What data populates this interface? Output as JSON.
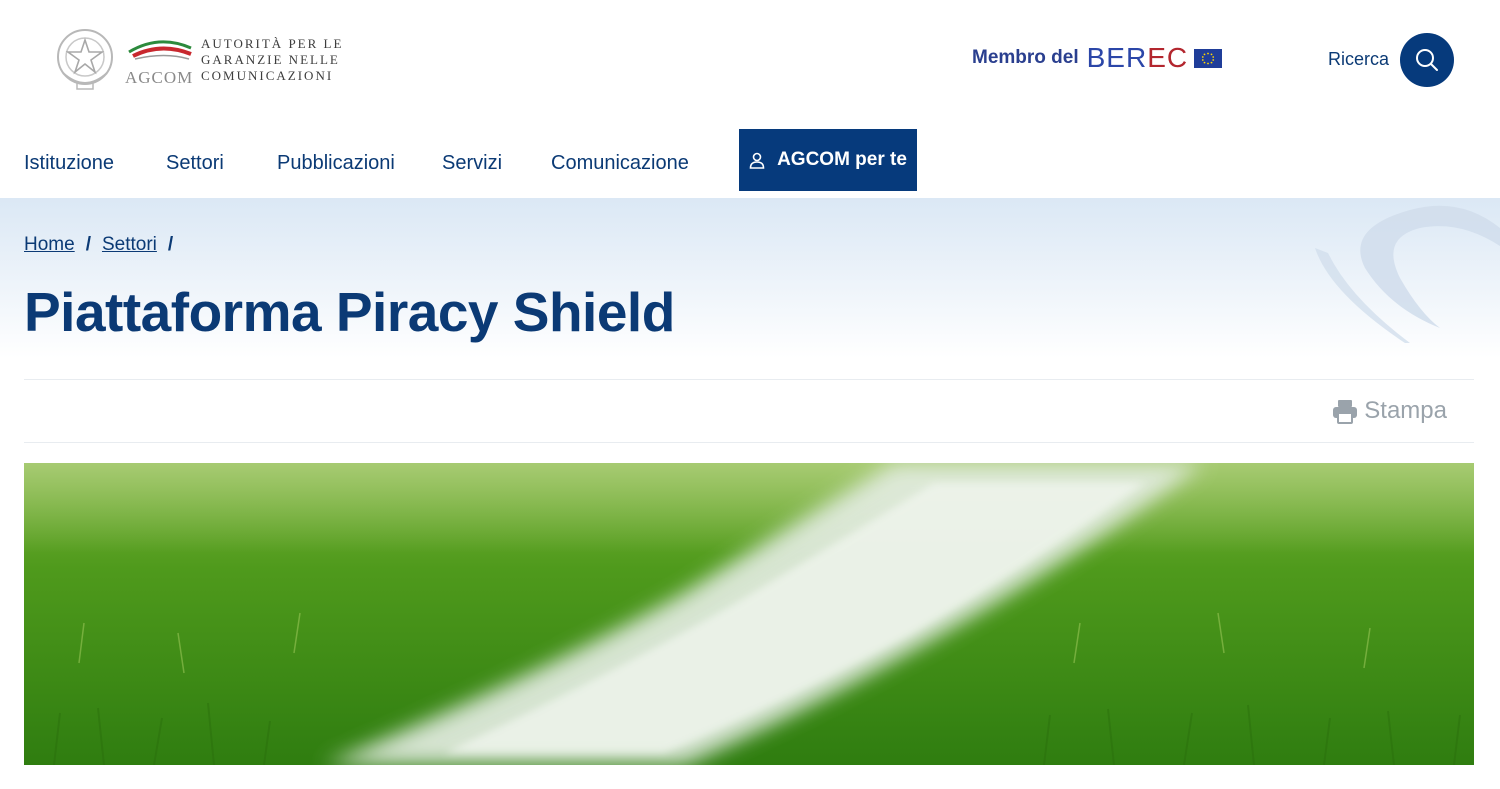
{
  "header": {
    "logo": {
      "org_line1": "AUTORITÀ PER LE",
      "org_line2": "GARANZIE NELLE",
      "org_line3": "COMUNICAZIONI",
      "mark_text": "AGCOM"
    },
    "berec": {
      "prefix": "Membro del",
      "brand_main": "BER",
      "brand_accent": "EC"
    },
    "search": {
      "label": "Ricerca",
      "icon": "search-icon"
    }
  },
  "nav": {
    "items": [
      {
        "label": "Istituzione"
      },
      {
        "label": "Settori"
      },
      {
        "label": "Pubblicazioni"
      },
      {
        "label": "Servizi"
      },
      {
        "label": "Comunicazione"
      }
    ],
    "cta": {
      "label": "AGCOM per te",
      "icon": "user-icon"
    }
  },
  "breadcrumb": {
    "items": [
      "Home",
      "Settori"
    ],
    "separator": "/"
  },
  "page": {
    "title": "Piattaforma Piracy Shield"
  },
  "tools": {
    "print_label": "Stampa",
    "print_icon": "printer-icon"
  },
  "colors": {
    "primary": "#063a7c",
    "text_primary": "#0b3a75",
    "muted": "#9aa3ab",
    "grass": "#4f9a1c",
    "pitch_line": "#e9f0ea"
  }
}
